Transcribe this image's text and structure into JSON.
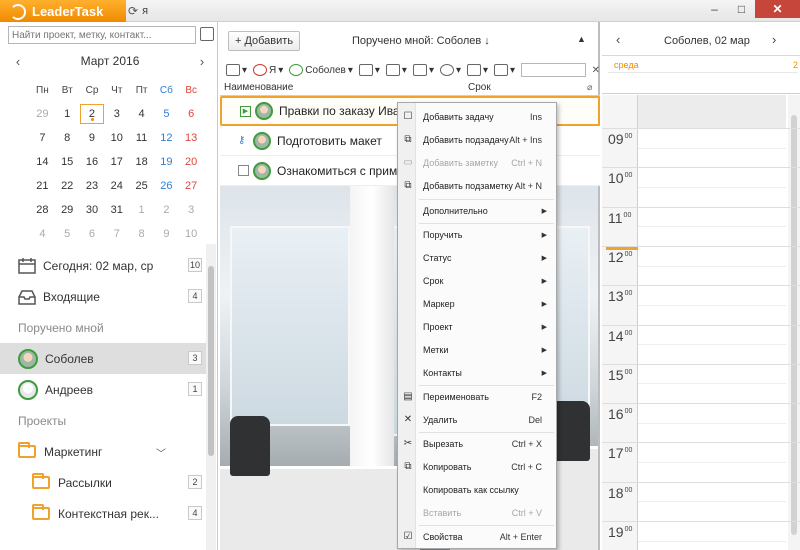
{
  "app": {
    "title": "LeaderTask",
    "user_label": "я",
    "window_buttons": [
      "–",
      "□",
      "✕"
    ],
    "brand_color": "#f08a00"
  },
  "left": {
    "search_placeholder": "Найти проект, метку, контакт...",
    "calendar": {
      "month": "Март 2016",
      "prev": "‹",
      "next": "›",
      "weekdays": [
        "Пн",
        "Вт",
        "Ср",
        "Чт",
        "Пт",
        "Сб",
        "Вс"
      ],
      "weeks": [
        [
          "29",
          "1",
          "2",
          "3",
          "4",
          "5",
          "6"
        ],
        [
          "7",
          "8",
          "9",
          "10",
          "11",
          "12",
          "13"
        ],
        [
          "14",
          "15",
          "16",
          "17",
          "18",
          "19",
          "20"
        ],
        [
          "21",
          "22",
          "23",
          "24",
          "25",
          "26",
          "27"
        ],
        [
          "28",
          "29",
          "30",
          "31",
          "1",
          "2",
          "3"
        ],
        [
          "4",
          "5",
          "6",
          "7",
          "8",
          "9",
          "10"
        ]
      ],
      "today": "2"
    },
    "nav": {
      "today": {
        "label": "Сегодня: 02 мар, ср",
        "count": "10"
      },
      "inbox": {
        "label": "Входящие",
        "count": "4"
      },
      "assigned_section": "Поручено мной",
      "sobolev": {
        "label": "Соболев",
        "count": "3"
      },
      "andreev": {
        "label": "Андреев",
        "count": "1"
      },
      "projects_section": "Проекты",
      "marketing": {
        "label": "Маркетинг",
        "chevron": "﹀"
      },
      "mailings": {
        "label": "Рассылки",
        "count": "2"
      },
      "context_ads": {
        "label": "Контекстная рек...",
        "count": "4"
      }
    }
  },
  "middle": {
    "add_label": "Добавить",
    "add_glyph": "+",
    "title": "Поручено мной: Соболев ↓",
    "collapse_glyph": "▲",
    "toolbar": {
      "me": "Я",
      "sobolev": "Соболев",
      "dropdown_glyph": "▾"
    },
    "columns": {
      "name": "Наименование",
      "due": "Срок"
    },
    "tasks": [
      {
        "title": "Правки по заказу Иванов",
        "state": "in-progress"
      },
      {
        "title": "Подготовить макет",
        "state": "key"
      },
      {
        "title": "Ознакомиться с примерами",
        "state": "open"
      }
    ]
  },
  "context_menu": {
    "items": [
      {
        "label": "Добавить задачу",
        "shortcut": "Ins",
        "icon": "☐",
        "disabled": false,
        "submenu": false
      },
      {
        "label": "Добавить подзадачу",
        "shortcut": "Alt + Ins",
        "icon": "⧉",
        "disabled": false,
        "submenu": false
      },
      {
        "label": "Добавить заметку",
        "shortcut": "Ctrl + N",
        "icon": "▭",
        "disabled": true,
        "submenu": false
      },
      {
        "label": "Добавить подзаметку",
        "shortcut": "Alt + N",
        "icon": "⧉",
        "disabled": false,
        "submenu": false
      },
      {
        "label": "Дополнительно",
        "shortcut": "",
        "icon": "",
        "disabled": false,
        "submenu": true
      },
      {
        "label": "Поручить",
        "shortcut": "",
        "icon": "",
        "disabled": false,
        "submenu": true
      },
      {
        "label": "Статус",
        "shortcut": "",
        "icon": "",
        "disabled": false,
        "submenu": true
      },
      {
        "label": "Срок",
        "shortcut": "",
        "icon": "",
        "disabled": false,
        "submenu": true
      },
      {
        "label": "Маркер",
        "shortcut": "",
        "icon": "",
        "disabled": false,
        "submenu": true
      },
      {
        "label": "Проект",
        "shortcut": "",
        "icon": "",
        "disabled": false,
        "submenu": true
      },
      {
        "label": "Метки",
        "shortcut": "",
        "icon": "",
        "disabled": false,
        "submenu": true
      },
      {
        "label": "Контакты",
        "shortcut": "",
        "icon": "",
        "disabled": false,
        "submenu": true
      },
      {
        "label": "Переименовать",
        "shortcut": "F2",
        "icon": "▤",
        "disabled": false,
        "submenu": false
      },
      {
        "label": "Удалить",
        "shortcut": "Del",
        "icon": "✕",
        "disabled": false,
        "submenu": false
      },
      {
        "label": "Вырезать",
        "shortcut": "Ctrl + X",
        "icon": "✂",
        "disabled": false,
        "submenu": false
      },
      {
        "label": "Копировать",
        "shortcut": "Ctrl + C",
        "icon": "⧉",
        "disabled": false,
        "submenu": false
      },
      {
        "label": "Копировать как ссылку",
        "shortcut": "",
        "icon": "",
        "disabled": false,
        "submenu": false
      },
      {
        "label": "Вставить",
        "shortcut": "Ctrl + V",
        "icon": "",
        "disabled": true,
        "submenu": false
      },
      {
        "label": "Свойства",
        "shortcut": "Alt + Enter",
        "icon": "☑",
        "disabled": false,
        "submenu": false
      }
    ],
    "submenu_glyph": "▶"
  },
  "right": {
    "title": "Соболев, 02 мар",
    "prev": "‹",
    "next": "›",
    "day_name": "среда",
    "day_count": "2",
    "hours": [
      "09",
      "10",
      "11",
      "12",
      "13",
      "14",
      "15",
      "16",
      "17",
      "18",
      "19"
    ],
    "minutes": "00"
  }
}
